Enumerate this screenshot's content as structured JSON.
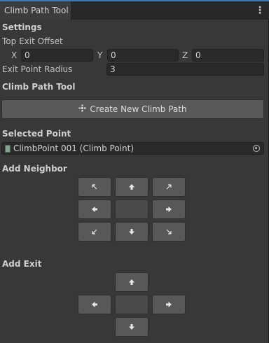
{
  "tab": {
    "title": "Climb Path Tool",
    "menu_icon": "kebab-menu-icon"
  },
  "settings": {
    "header": "Settings",
    "top_exit_offset": {
      "label": "Top Exit Offset",
      "x_label": "X",
      "x_value": "0",
      "y_label": "Y",
      "y_value": "0",
      "z_label": "Z",
      "z_value": "0"
    },
    "exit_point_radius": {
      "label": "Exit Point Radius",
      "value": "3"
    }
  },
  "tool": {
    "header": "Climb Path Tool",
    "create_button_icon": "plus-icon",
    "create_button_label": "Create New Climb Path"
  },
  "selected_point": {
    "header": "Selected Point",
    "object_icon": "script-object-icon",
    "value": "ClimbPoint 001 (Climb Point)",
    "picker_icon": "object-picker-icon"
  },
  "add_neighbor": {
    "header": "Add Neighbor",
    "buttons": [
      "arrow-up-left-icon",
      "arrow-up-icon",
      "arrow-up-right-icon",
      "arrow-left-icon",
      "empty",
      "arrow-right-icon",
      "arrow-down-left-icon",
      "arrow-down-icon",
      "arrow-down-right-icon"
    ]
  },
  "add_exit": {
    "header": "Add Exit",
    "buttons": [
      "arrow-up-icon",
      "arrow-left-icon",
      "empty",
      "arrow-right-icon",
      "arrow-down-icon"
    ]
  },
  "colors": {
    "accent": "#3a79bb",
    "panel": "#383838",
    "button": "#585858",
    "field": "#2a2a2a"
  }
}
